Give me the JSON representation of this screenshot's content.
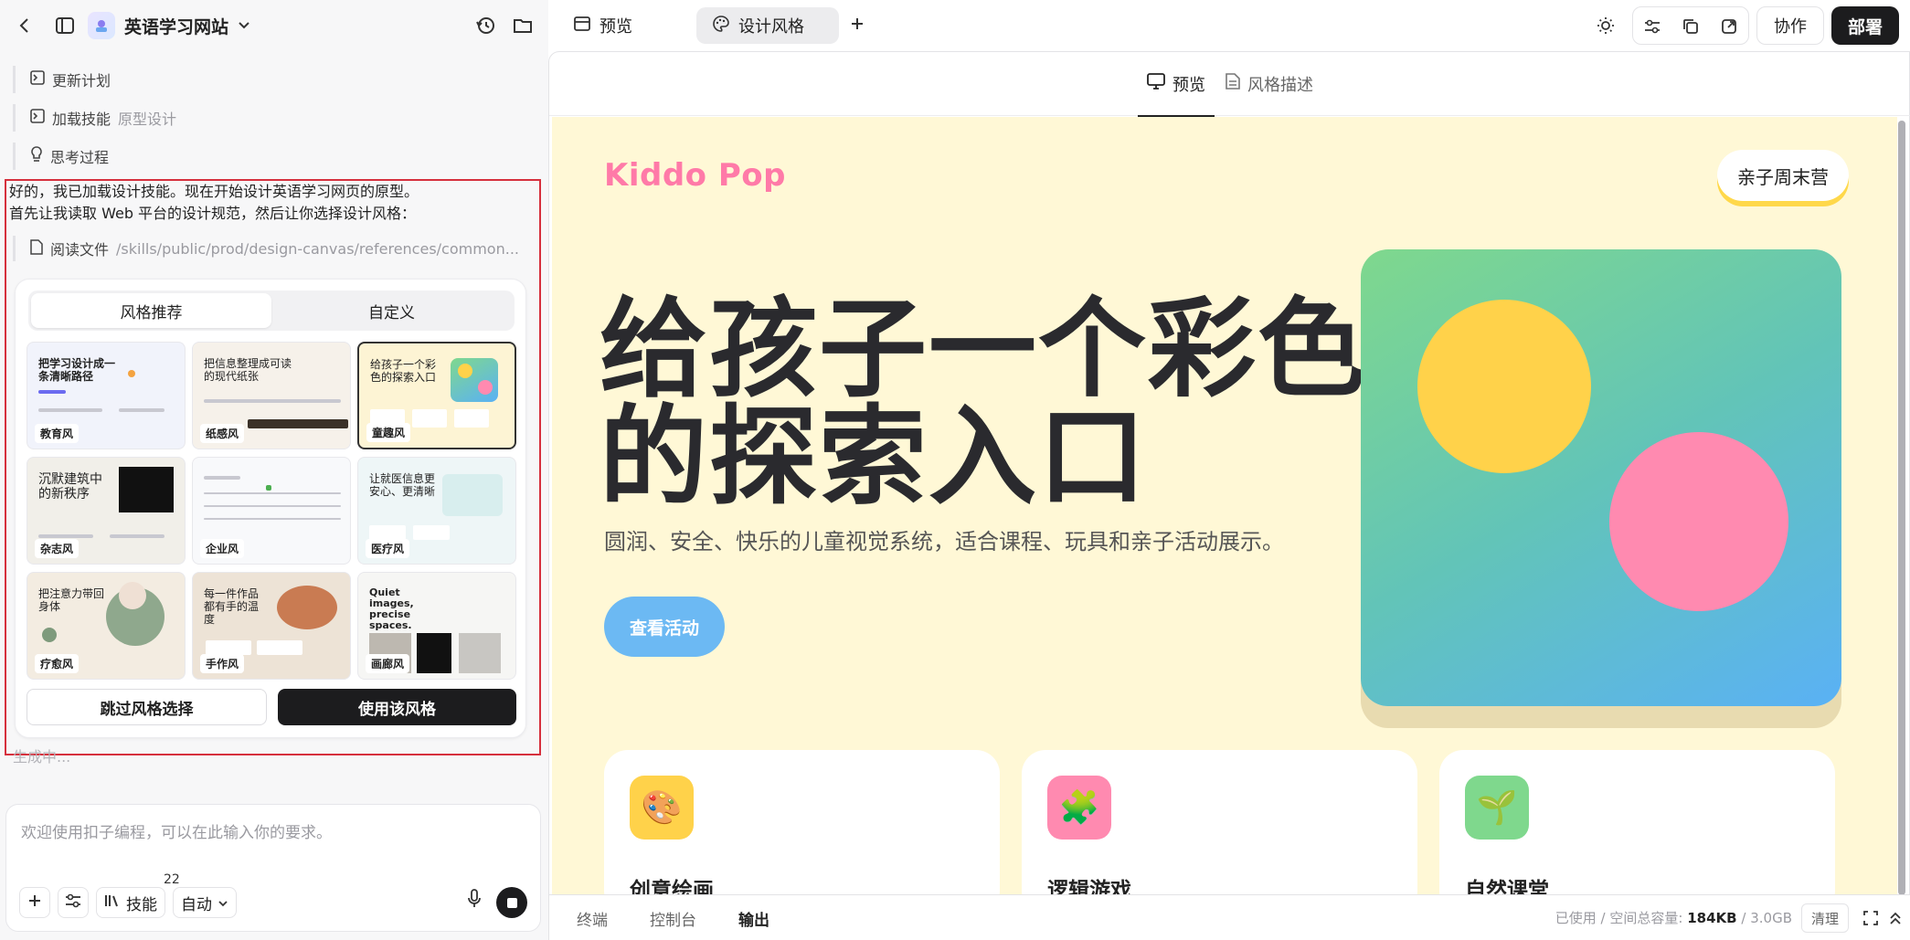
{
  "project": {
    "title": "英语学习网站"
  },
  "top_tabs": [
    {
      "label": "预览"
    },
    {
      "label": "设计风格"
    }
  ],
  "actions": {
    "collab": "协作",
    "deploy": "部署"
  },
  "steps": [
    {
      "label": "更新计划",
      "extra": ""
    },
    {
      "label": "加载技能",
      "extra": "原型设计"
    },
    {
      "label": "思考过程",
      "extra": ""
    }
  ],
  "message": {
    "line1": "好的，我已加载设计技能。现在开始设计英语学习网页的原型。",
    "line2": "首先让我读取 Web 平台的设计规范，然后让你选择设计风格："
  },
  "read_file": {
    "label": "阅读文件",
    "path": "/skills/public/prod/design-canvas/references/common..."
  },
  "style_card": {
    "tabs": [
      "风格推荐",
      "自定义"
    ],
    "styles": [
      "教育风",
      "纸感风",
      "童趣风",
      "杂志风",
      "企业风",
      "医疗风",
      "疗愈风",
      "手作风",
      "画廊风"
    ],
    "thumb_heads": [
      "把学习设计成一条清晰路径",
      "把信息整理成可读的现代纸张",
      "给孩子一个彩色的探索入口",
      "沉默建筑中的新秩序",
      "",
      "让就医信息更安心、更清晰",
      "把注意力带回身体",
      "每一件作品都有手的温度",
      "Quiet images, precise spaces."
    ],
    "skip": "跳过风格选择",
    "use": "使用该风格"
  },
  "status": "生成中...",
  "input": {
    "placeholder": "欢迎使用扣子编程，可以在此输入你的要求。",
    "skills_label": "技能",
    "skills_count": "22",
    "mode": "自动"
  },
  "preview": {
    "subtabs": [
      "预览",
      "风格描述"
    ],
    "brand": "Kiddo Pop",
    "top_cta": "亲子周末营",
    "hero_title_1": "给孩子一个彩色",
    "hero_title_2": "的探索入口",
    "hero_sub": "圆润、安全、快乐的儿童视觉系统，适合课程、玩具和亲子活动展示。",
    "hero_button": "查看活动",
    "features": [
      {
        "title": "创意绘画",
        "icon": "🎨"
      },
      {
        "title": "逻辑游戏",
        "icon": "🧩"
      },
      {
        "title": "自然课堂",
        "icon": "🌱"
      }
    ]
  },
  "bottom": {
    "tabs": [
      "终端",
      "控制台",
      "输出"
    ],
    "usage_label": "已使用 / 空间总容量:",
    "used": "184KB",
    "sep": "/",
    "total": "3.0GB",
    "clean": "清理"
  },
  "colors": {
    "brand_pink": "#ff7aa8",
    "sun": "#ffd24a",
    "deploy": "#1c1c1e",
    "highlight": "#d6303d"
  }
}
